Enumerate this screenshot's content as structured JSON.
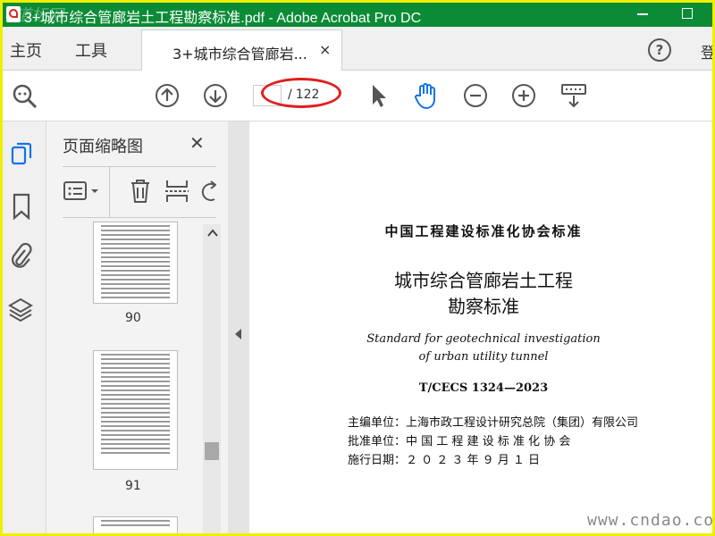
{
  "window": {
    "title": "3+城市综合管廊岩土工程勘察标准.pdf - Adobe Acrobat Pro DC",
    "watermark_top": "道标网"
  },
  "nav": {
    "home": "主页",
    "tools": "工具",
    "tab_label": "3+城市综合管廊岩...",
    "tab_close": "×",
    "help": "?",
    "login": "登"
  },
  "toolbar": {
    "page_input": "",
    "page_total": "122",
    "slash": "/"
  },
  "sidepanel": {
    "title": "页面缩略图",
    "close": "✕",
    "thumbs": [
      {
        "label": "90"
      },
      {
        "label": "91"
      }
    ]
  },
  "document": {
    "org": "中国工程建设标准化协会标准",
    "title_line1": "城市综合管廊岩土工程",
    "title_line2": "勘察标准",
    "english_line1": "Standard for geotechnical investigation",
    "english_line2": "of urban utility tunnel",
    "code": "T/CECS 1324—2023",
    "editor": "主编单位：上海市政工程设计研究总院（集团）有限公司",
    "approver": "批准单位：中  国  工  程  建  设  标  准  化  协  会",
    "effective": "施行日期：２  ０  ２  ３  年  ９  月  １  日",
    "watermark": "www.cndao.com"
  },
  "colors": {
    "titlebar": "#0b8b36",
    "frame": "#eef000",
    "annotation_oval": "#e02020",
    "selected_tool": "#1473e6"
  },
  "icons": [
    "app-icon",
    "minimize-icon",
    "maximize-icon",
    "help-icon",
    "zoom-search-icon",
    "page-up-icon",
    "page-down-icon",
    "select-pointer-icon",
    "hand-tool-icon",
    "zoom-out-icon",
    "zoom-in-icon",
    "page-view-icon",
    "page-thumbnails-icon",
    "bookmark-icon",
    "attachment-icon",
    "layers-icon",
    "list-options-icon",
    "trash-icon",
    "extract-icon",
    "rotate-icon",
    "collapse-arrow-icon"
  ]
}
